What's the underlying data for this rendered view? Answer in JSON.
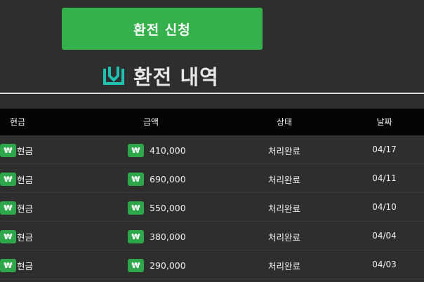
{
  "apply_button": {
    "label": "환전 신청"
  },
  "history": {
    "title": "환전 내역"
  },
  "table": {
    "headers": {
      "type": "현금",
      "amount": "금액",
      "status": "상태",
      "date": "날짜"
    },
    "rows": [
      {
        "currency_symbol": "₩",
        "type": "현금",
        "amount_symbol": "₩",
        "amount": "410,000",
        "status": "처리완료",
        "date": "04/17"
      },
      {
        "currency_symbol": "₩",
        "type": "현금",
        "amount_symbol": "₩",
        "amount": "690,000",
        "status": "처리완료",
        "date": "04/11"
      },
      {
        "currency_symbol": "₩",
        "type": "현금",
        "amount_symbol": "₩",
        "amount": "550,000",
        "status": "처리완료",
        "date": "04/10"
      },
      {
        "currency_symbol": "₩",
        "type": "현금",
        "amount_symbol": "₩",
        "amount": "380,000",
        "status": "처리완료",
        "date": "04/04"
      },
      {
        "currency_symbol": "₩",
        "type": "현금",
        "amount_symbol": "₩",
        "amount": "290,000",
        "status": "처리완료",
        "date": "04/03"
      }
    ]
  },
  "colors": {
    "accent_green": "#35b14c",
    "icon_teal": "#1fc2b0",
    "background": "#2e2e2e",
    "header_bg": "#050505"
  },
  "icons": {
    "title_icon": "download-box-icon",
    "currency_badge": "won-badge-icon"
  }
}
